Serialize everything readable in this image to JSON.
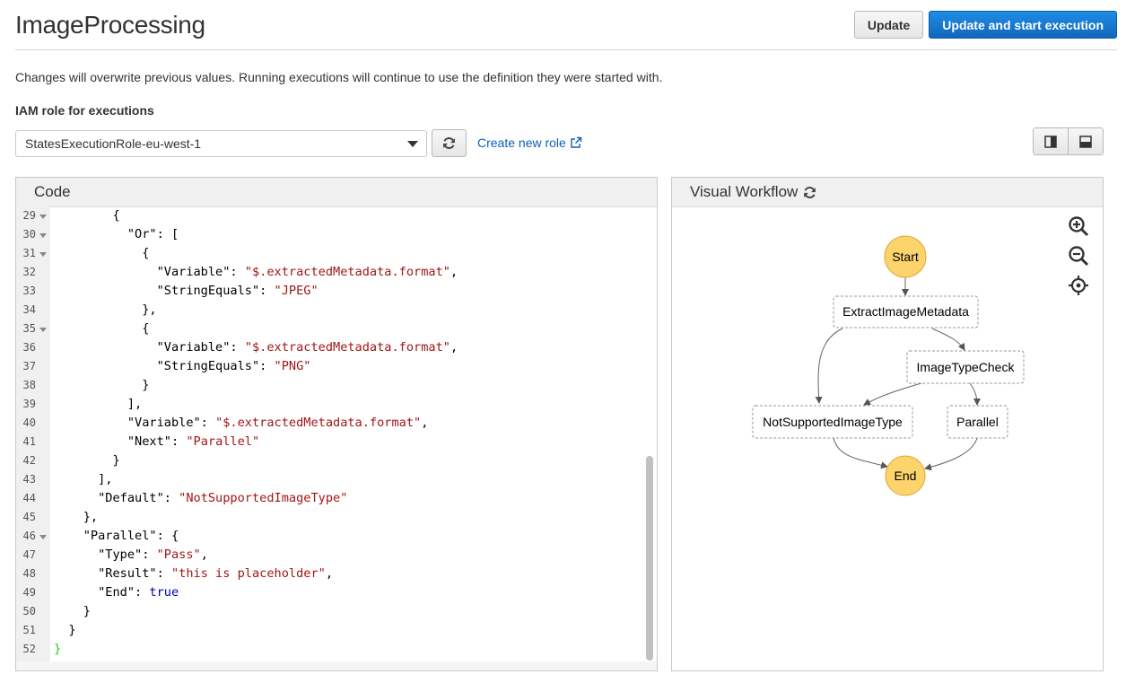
{
  "header": {
    "title": "ImageProcessing",
    "update_label": "Update",
    "update_start_label": "Update and start execution"
  },
  "description": "Changes will overwrite previous values. Running executions will continue to use the definition they were started with.",
  "iam": {
    "label": "IAM role for executions",
    "selected_role": "StatesExecutionRole-eu-west-1",
    "create_role_label": "Create new role"
  },
  "code_panel": {
    "title": "Code",
    "lines": [
      {
        "n": "29",
        "fold": true
      },
      {
        "n": "30",
        "fold": true
      },
      {
        "n": "31",
        "fold": true
      },
      {
        "n": "32",
        "fold": false
      },
      {
        "n": "33",
        "fold": false
      },
      {
        "n": "34",
        "fold": false
      },
      {
        "n": "35",
        "fold": true
      },
      {
        "n": "36",
        "fold": false
      },
      {
        "n": "37",
        "fold": false
      },
      {
        "n": "38",
        "fold": false
      },
      {
        "n": "39",
        "fold": false
      },
      {
        "n": "40",
        "fold": false
      },
      {
        "n": "41",
        "fold": false
      },
      {
        "n": "42",
        "fold": false
      },
      {
        "n": "43",
        "fold": false
      },
      {
        "n": "44",
        "fold": false
      },
      {
        "n": "45",
        "fold": false
      },
      {
        "n": "46",
        "fold": true
      },
      {
        "n": "47",
        "fold": false
      },
      {
        "n": "48",
        "fold": false
      },
      {
        "n": "49",
        "fold": false
      },
      {
        "n": "50",
        "fold": false
      },
      {
        "n": "51",
        "fold": false
      },
      {
        "n": "52",
        "fold": false
      }
    ],
    "tokens": {
      "l29_a": "        {",
      "l30_a": "          \"Or\": [",
      "l31_a": "            {",
      "l32_k": "              \"Variable\": ",
      "l32_v": "\"$.extractedMetadata.format\"",
      "l32_e": ",",
      "l33_k": "              \"StringEquals\": ",
      "l33_v": "\"JPEG\"",
      "l34_a": "            },",
      "l35_a": "            {",
      "l36_k": "              \"Variable\": ",
      "l36_v": "\"$.extractedMetadata.format\"",
      "l36_e": ",",
      "l37_k": "              \"StringEquals\": ",
      "l37_v": "\"PNG\"",
      "l38_a": "            }",
      "l39_a": "          ],",
      "l40_k": "          \"Variable\": ",
      "l40_v": "\"$.extractedMetadata.format\"",
      "l40_e": ",",
      "l41_k": "          \"Next\": ",
      "l41_v": "\"Parallel\"",
      "l42_a": "        }",
      "l43_a": "      ],",
      "l44_k": "      \"Default\": ",
      "l44_v": "\"NotSupportedImageType\"",
      "l45_a": "    },",
      "l46_a": "    \"Parallel\": {",
      "l47_k": "      \"Type\": ",
      "l47_v": "\"Pass\"",
      "l47_e": ",",
      "l48_k": "      \"Result\": ",
      "l48_v": "\"this is placeholder\"",
      "l48_e": ",",
      "l49_k": "      \"End\": ",
      "l49_v": "true",
      "l50_a": "    }",
      "l51_a": "  }",
      "l52_a": "}"
    }
  },
  "workflow_panel": {
    "title": "Visual Workflow",
    "nodes": {
      "start": "Start",
      "extract": "ExtractImageMetadata",
      "check": "ImageTypeCheck",
      "notsupported": "NotSupportedImageType",
      "parallel": "Parallel",
      "end": "End"
    },
    "colors": {
      "terminal_fill": "#fdd36c",
      "terminal_stroke": "#e0a73a",
      "state_stroke": "#999999"
    },
    "tools": [
      "zoom-in-icon",
      "zoom-out-icon",
      "center-icon"
    ]
  },
  "colors": {
    "primary": "#1a78d3",
    "link": "#0b5fb8",
    "string": "#a31515",
    "keyword": "#0000aa"
  }
}
